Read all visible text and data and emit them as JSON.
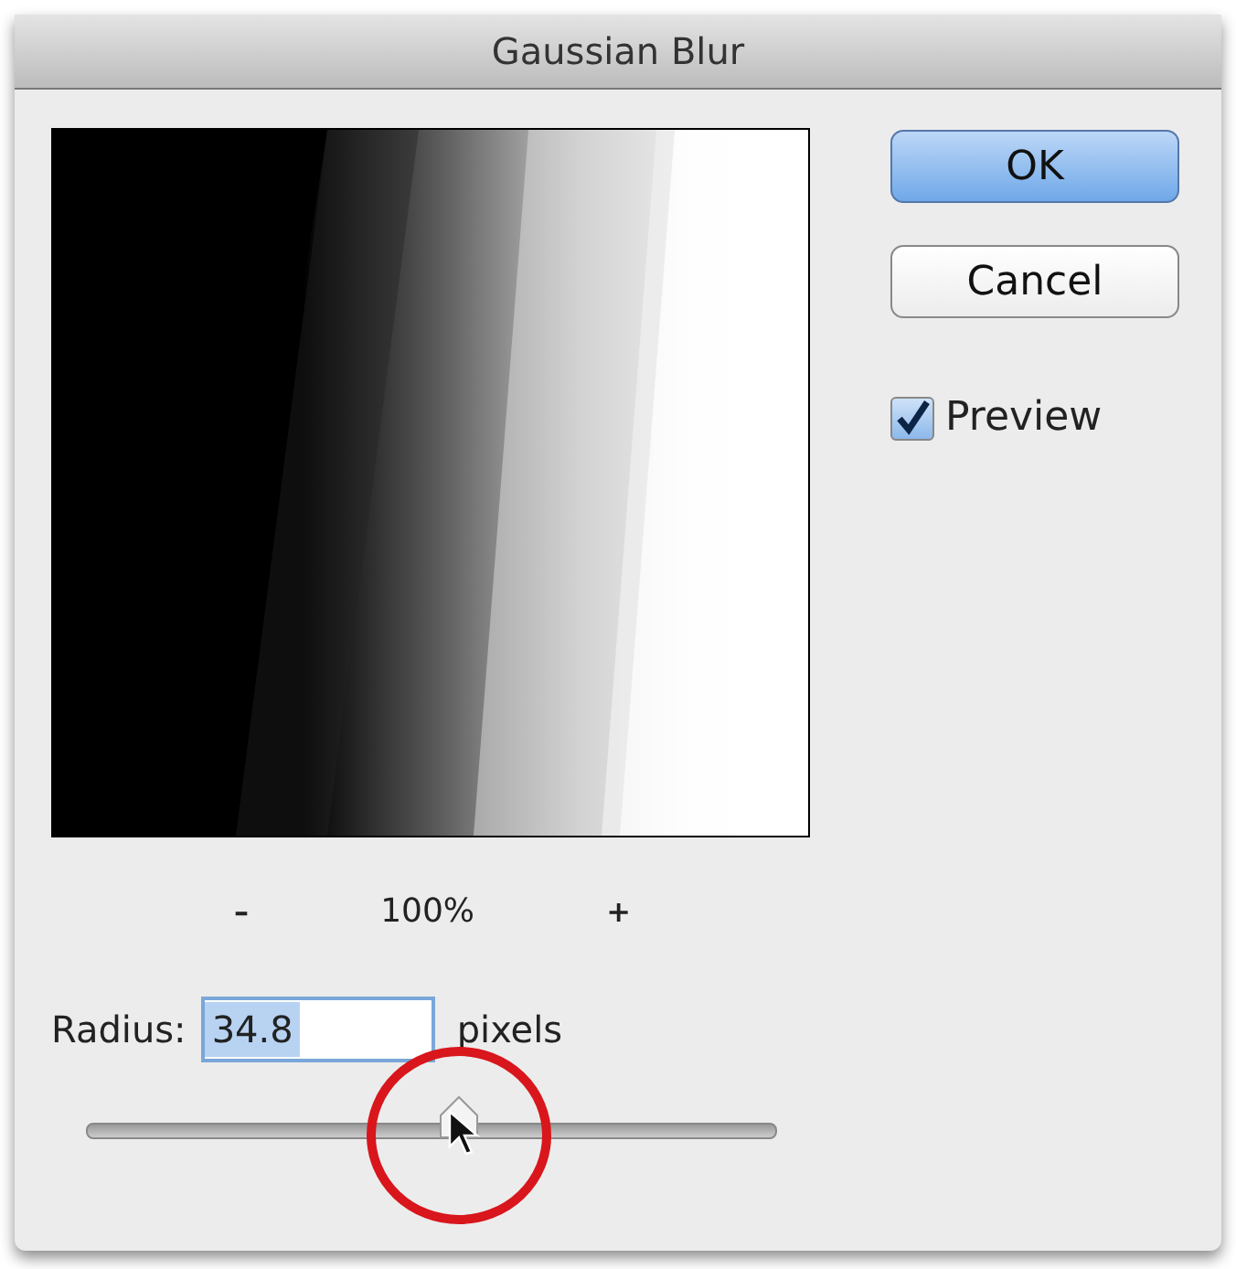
{
  "window": {
    "title": "Gaussian Blur"
  },
  "zoom": {
    "minus": "–",
    "value": "100%",
    "plus": "+"
  },
  "buttons": [
    {
      "label": "OK",
      "default": true
    },
    {
      "label": "Cancel",
      "default": false
    }
  ],
  "preview_checkbox": {
    "label": "Preview",
    "checked": true
  },
  "radius": {
    "label": "Radius:",
    "value": "34.8",
    "unit": "pixels",
    "level": 0.54
  }
}
